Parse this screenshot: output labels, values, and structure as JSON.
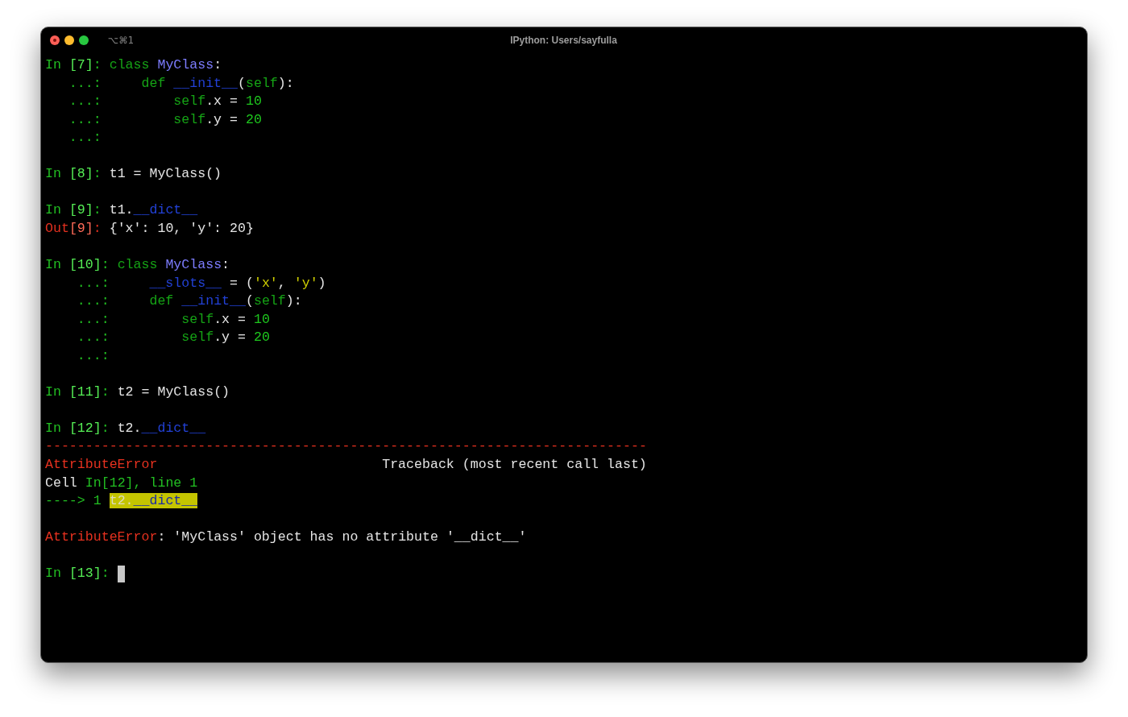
{
  "window": {
    "buttons": [
      {
        "kind": "close"
      },
      {
        "kind": "minimize"
      },
      {
        "kind": "zoom"
      }
    ],
    "shortcut": "⌥⌘1",
    "title": "IPython: Users/sayfulla"
  },
  "terminal": {
    "cells": [
      {
        "input": {
          "prompt": [
            {
              "text": "In ",
              "kind": "in"
            },
            {
              "text": "[7]",
              "kind": "in_number"
            },
            {
              "text": ":",
              "kind": "in"
            }
          ],
          "lines": [
            {
              "code": [
                {
                  "text": "class ",
                  "kind": "keyword"
                },
                {
                  "text": "MyClass",
                  "kind": "class_name"
                },
                {
                  "text": ":",
                  "kind": "plain"
                }
              ]
            },
            {
              "continuation": "...:",
              "code": [
                {
                  "text": "    def ",
                  "kind": "keyword"
                },
                {
                  "text": "__init__",
                  "kind": "dunder"
                },
                {
                  "text": "(",
                  "kind": "plain"
                },
                {
                  "text": "self",
                  "kind": "keyword"
                },
                {
                  "text": "):",
                  "kind": "plain"
                }
              ]
            },
            {
              "continuation": "...:",
              "code": [
                {
                  "text": "        self",
                  "kind": "keyword"
                },
                {
                  "text": ".x = ",
                  "kind": "plain"
                },
                {
                  "text": "10",
                  "kind": "number"
                }
              ]
            },
            {
              "continuation": "...:",
              "code": [
                {
                  "text": "        self",
                  "kind": "keyword"
                },
                {
                  "text": ".y = ",
                  "kind": "plain"
                },
                {
                  "text": "20",
                  "kind": "number"
                }
              ]
            },
            {
              "continuation": "...:"
            }
          ]
        }
      },
      {
        "input": {
          "prompt": [
            {
              "text": "In ",
              "kind": "in"
            },
            {
              "text": "[8]",
              "kind": "in_number"
            },
            {
              "text": ":",
              "kind": "in"
            }
          ],
          "lines": [
            {
              "code": [
                {
                  "text": "t1 = MyClass()",
                  "kind": "plain"
                }
              ]
            }
          ]
        }
      },
      {
        "input": {
          "prompt": [
            {
              "text": "In ",
              "kind": "in"
            },
            {
              "text": "[9]",
              "kind": "in_number"
            },
            {
              "text": ":",
              "kind": "in"
            }
          ],
          "lines": [
            {
              "code": [
                {
                  "text": "t1.",
                  "kind": "plain"
                },
                {
                  "text": "__dict__",
                  "kind": "dunder"
                }
              ]
            }
          ]
        },
        "output": {
          "prompt": [
            {
              "text": "Out",
              "kind": "out"
            },
            {
              "text": "[9]",
              "kind": "out_number"
            },
            {
              "text": ":",
              "kind": "out"
            }
          ],
          "lines": [
            {
              "code": [
                {
                  "text": "{'x': 10, 'y': 20}",
                  "kind": "plain"
                }
              ]
            }
          ]
        }
      },
      {
        "input": {
          "prompt": [
            {
              "text": "In ",
              "kind": "in"
            },
            {
              "text": "[10]",
              "kind": "in_number"
            },
            {
              "text": ":",
              "kind": "in"
            }
          ],
          "lines": [
            {
              "code": [
                {
                  "text": "class ",
                  "kind": "keyword"
                },
                {
                  "text": "MyClass",
                  "kind": "class_name"
                },
                {
                  "text": ":",
                  "kind": "plain"
                }
              ]
            },
            {
              "continuation": "...:",
              "code": [
                {
                  "text": "    __slots__",
                  "kind": "dunder"
                },
                {
                  "text": " = (",
                  "kind": "plain"
                },
                {
                  "text": "'x'",
                  "kind": "string"
                },
                {
                  "text": ", ",
                  "kind": "plain"
                },
                {
                  "text": "'y'",
                  "kind": "string"
                },
                {
                  "text": ")",
                  "kind": "plain"
                }
              ]
            },
            {
              "continuation": "...:",
              "code": [
                {
                  "text": "    def ",
                  "kind": "keyword"
                },
                {
                  "text": "__init__",
                  "kind": "dunder"
                },
                {
                  "text": "(",
                  "kind": "plain"
                },
                {
                  "text": "self",
                  "kind": "keyword"
                },
                {
                  "text": "):",
                  "kind": "plain"
                }
              ]
            },
            {
              "continuation": "...:",
              "code": [
                {
                  "text": "        self",
                  "kind": "keyword"
                },
                {
                  "text": ".x = ",
                  "kind": "plain"
                },
                {
                  "text": "10",
                  "kind": "number"
                }
              ]
            },
            {
              "continuation": "...:",
              "code": [
                {
                  "text": "        self",
                  "kind": "keyword"
                },
                {
                  "text": ".y = ",
                  "kind": "plain"
                },
                {
                  "text": "20",
                  "kind": "number"
                }
              ]
            },
            {
              "continuation": "...:"
            }
          ]
        }
      },
      {
        "input": {
          "prompt": [
            {
              "text": "In ",
              "kind": "in"
            },
            {
              "text": "[11]",
              "kind": "in_number"
            },
            {
              "text": ":",
              "kind": "in"
            }
          ],
          "lines": [
            {
              "code": [
                {
                  "text": "t2 = MyClass()",
                  "kind": "plain"
                }
              ]
            }
          ]
        }
      },
      {
        "input": {
          "prompt": [
            {
              "text": "In ",
              "kind": "in"
            },
            {
              "text": "[12]",
              "kind": "in_number"
            },
            {
              "text": ":",
              "kind": "in"
            }
          ],
          "lines": [
            {
              "code": [
                {
                  "text": "t2.",
                  "kind": "plain"
                },
                {
                  "text": "__dict__",
                  "kind": "dunder"
                }
              ]
            }
          ]
        },
        "error": {
          "rule": "---------------------------------------------------------------------------",
          "name": "AttributeError",
          "title": "Traceback (most recent call last)",
          "frames": [
            {
              "kind": "location",
              "segments": [
                {
                  "text": "Cell ",
                  "kind": "plain"
                },
                {
                  "text": "In[12], line 1",
                  "kind": "location"
                }
              ]
            },
            {
              "kind": "source",
              "segments": [
                {
                  "text": "----> 1 ",
                  "kind": "arrow"
                }
              ],
              "highlight": [
                {
                  "text": "t2.",
                  "kind": "plain"
                },
                {
                  "text": "__dict__",
                  "kind": "dunder"
                }
              ]
            }
          ],
          "message": [
            {
              "text": "AttributeError",
              "kind": "error"
            },
            {
              "text": ": 'MyClass' object has no attribute '__dict__'",
              "kind": "plain"
            }
          ]
        }
      },
      {
        "input": {
          "prompt": [
            {
              "text": "In ",
              "kind": "in"
            },
            {
              "text": "[13]",
              "kind": "in_number"
            },
            {
              "text": ":",
              "kind": "in"
            }
          ],
          "cursor": true
        }
      }
    ]
  }
}
